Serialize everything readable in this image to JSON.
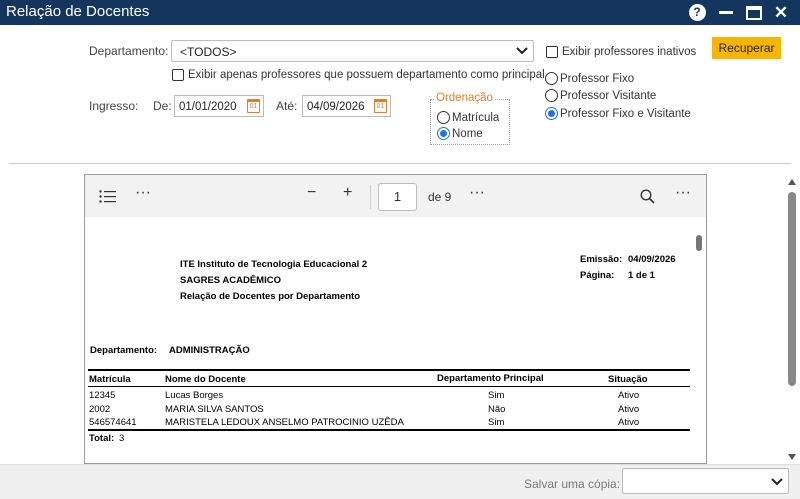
{
  "window": {
    "title": "Relação de Docentes"
  },
  "filters": {
    "departamento_label": "Departamento:",
    "departamento_value": "<TODOS>",
    "only_main_dept_label": "Exibir apenas professores que possuem departamento como principal",
    "ingresso_label": "Ingresso:",
    "de_label": "De:",
    "de_value": "01/01/2020",
    "ate_label": "Até:",
    "ate_value": "04/09/2026",
    "calendar_badge": "01",
    "show_inactive_label": "Exibir professores inativos",
    "ordenacao_legend": "Ordenação",
    "order_matricula": "Matrícula",
    "order_nome": "Nome",
    "tipo_fixo": "Professor Fixo",
    "tipo_visitante": "Professor Visitante",
    "tipo_ambos": "Professor Fixo e Visitante",
    "recuperar_label": "Recuperar"
  },
  "viewer": {
    "page_current": "1",
    "page_total_label": "de 9"
  },
  "report": {
    "institution": "ITE Instituto de Tecnologia Educacional 2",
    "system": "SAGRES ACADÊMICO",
    "title": "Relação de Docentes por Departamento",
    "emissao_label": "Emissão:",
    "emissao_value": "04/09/2026",
    "pagina_label": "Página:",
    "pagina_value": "1 de 1",
    "dept_label": "Departamento:",
    "dept_value": "ADMINISTRAÇÃO",
    "headers": [
      "Matrícula",
      "Nome do Docente",
      "Departamento Principal",
      "Situação"
    ],
    "rows": [
      [
        "12345",
        "Lucas Borges",
        "Sim",
        "Ativo"
      ],
      [
        "2002",
        "MARIA SILVA SANTOS",
        "Não",
        "Ativo"
      ],
      [
        "546574641",
        "MARISTELA LEDOUX ANSELMO PATROCINIO UZÊDA",
        "Sim",
        "Ativo"
      ]
    ],
    "total_label": "Total:",
    "total_value": "3"
  },
  "footer": {
    "save_copy_label": "Salvar uma cópia:"
  },
  "colors": {
    "titlebar": "#14365e",
    "accent_button": "#f7b500",
    "legend": "#e67e22",
    "radio_selected": "#1a73e8"
  }
}
